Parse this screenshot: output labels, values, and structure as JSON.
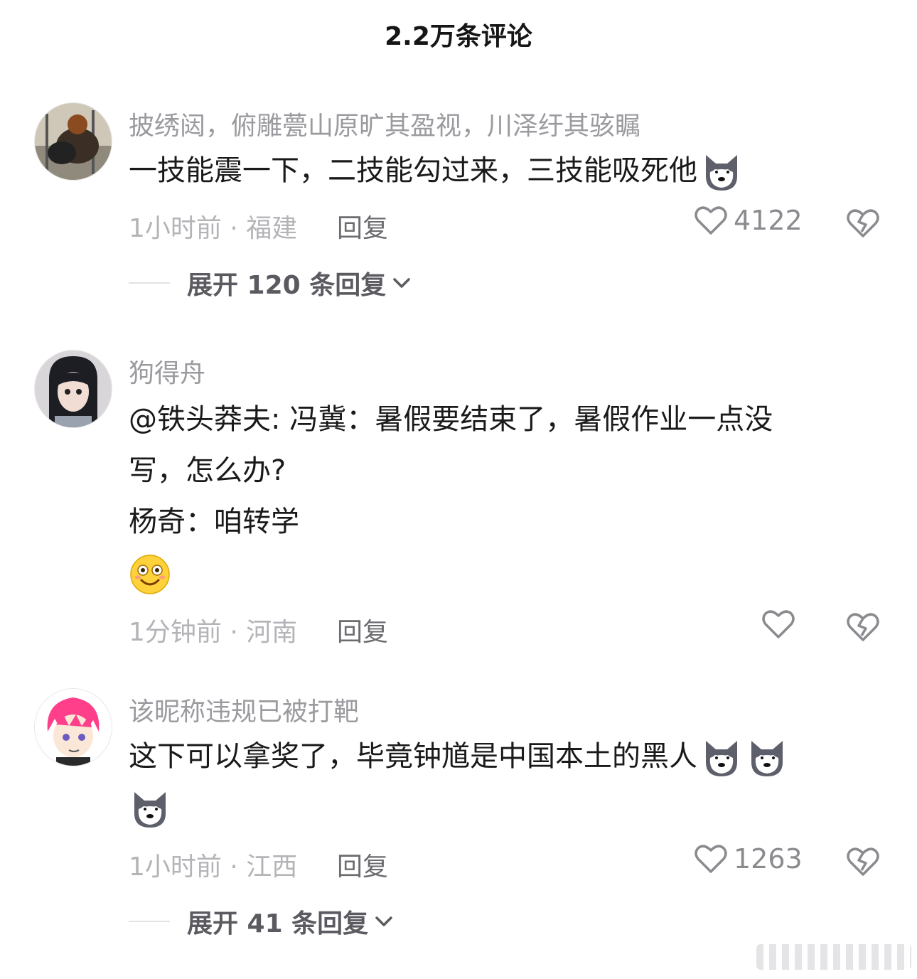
{
  "header": {
    "title": "2.2万条评论"
  },
  "comments": [
    {
      "username": "披绣闼，俯雕甍山原旷其盈视，川泽纡其骇瞩",
      "lines": [
        "一技能震一下，二技能勾过来，三技能吸死他"
      ],
      "time_location": "1小时前 · 福建",
      "reply_label": "回复",
      "likes": "4122",
      "expand_label": "展开 120 条回复"
    },
    {
      "username": "狗得舟",
      "lines": [
        "@铁头莽夫: 冯冀：暑假要结束了，暑假作业一点没",
        "写，怎么办?",
        "杨奇：咱转学"
      ],
      "time_location": "1分钟前 · 河南",
      "reply_label": "回复",
      "likes": ""
    },
    {
      "username": "该昵称违规已被打靶",
      "lines": [
        "这下可以拿奖了，毕竟钟馗是中国本土的黑人"
      ],
      "time_location": "1小时前 · 江西",
      "reply_label": "回复",
      "likes": "1263",
      "expand_label": "展开 41 条回复"
    }
  ],
  "icons": {
    "like": "heart-outline-icon",
    "dislike": "broken-heart-icon",
    "expand": "chevron-down-icon",
    "emoji_dog": "husky-emoji-icon",
    "emoji_smile": "smiling-emoji-icon"
  },
  "colors": {
    "text": "#1a1a1a",
    "muted": "#9a9a9f",
    "icon": "#8a8a8f"
  }
}
